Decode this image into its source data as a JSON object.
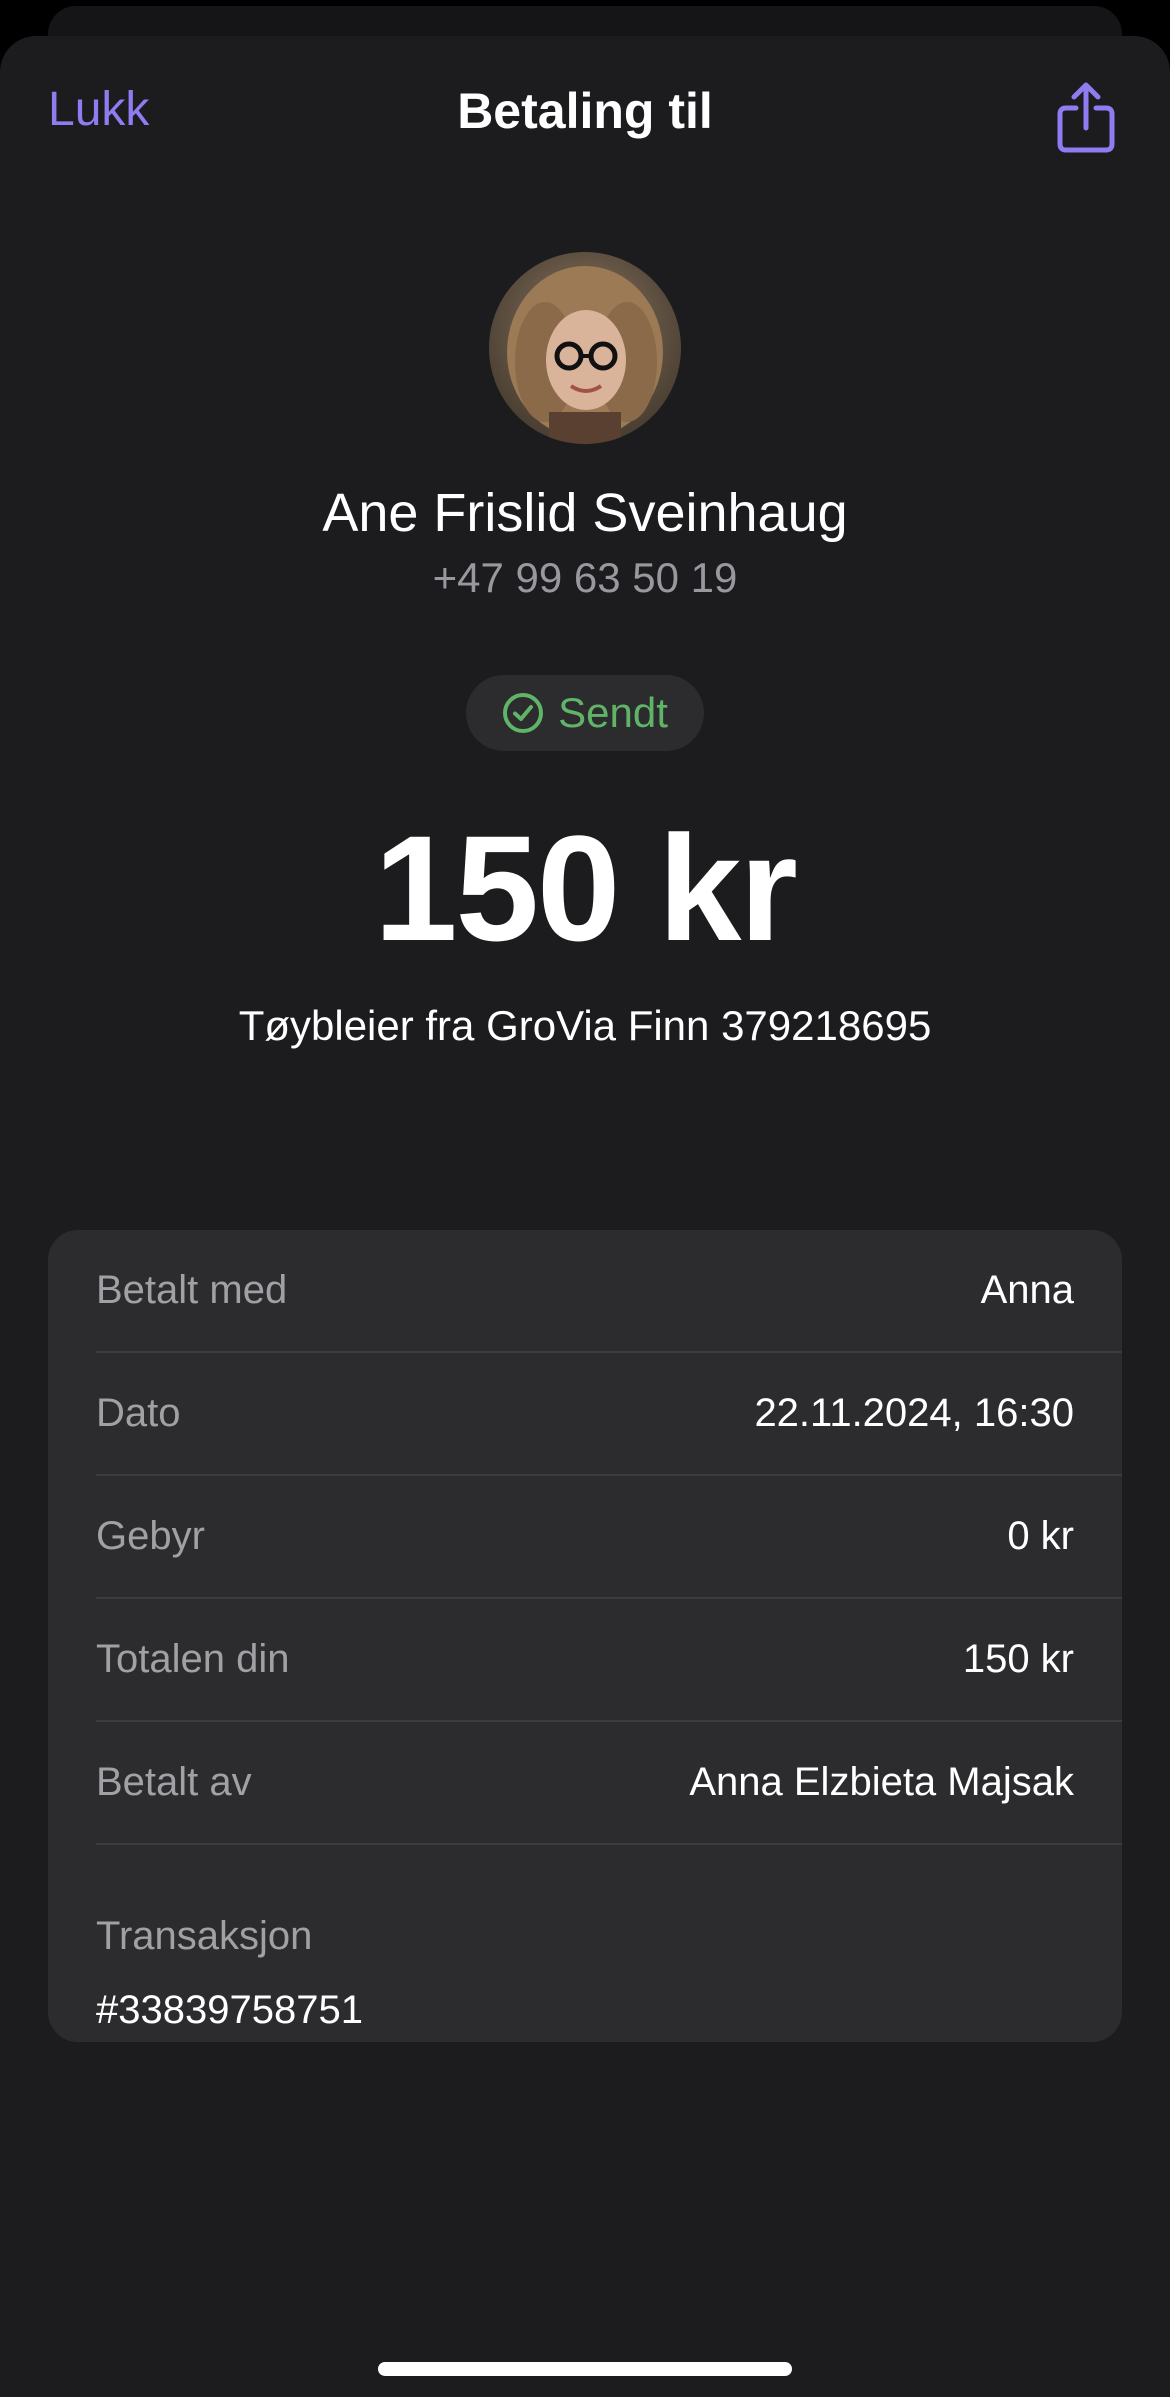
{
  "nav": {
    "close_label": "Lukk",
    "title": "Betaling til",
    "share_icon": "share-icon"
  },
  "recipient": {
    "name": "Ane Frislid Sveinhaug",
    "phone": "+47 99 63 50 19",
    "avatar": "avatar-photo"
  },
  "status": {
    "label": "Sendt",
    "icon": "check-circle-icon",
    "color": "#5fb468"
  },
  "payment": {
    "amount": "150 kr",
    "message": "Tøybleier fra GroVia Finn 379218695"
  },
  "details": {
    "rows": [
      {
        "label": "Betalt med",
        "value": "Anna"
      },
      {
        "label": "Dato",
        "value": "22.11.2024, 16:30"
      },
      {
        "label": "Gebyr",
        "value": "0 kr"
      },
      {
        "label": "Totalen din",
        "value": "150 kr"
      },
      {
        "label": "Betalt av",
        "value": "Anna Elzbieta Majsak"
      }
    ],
    "transaction_label": "Transaksjon",
    "transaction_value": "#33839758751"
  },
  "colors": {
    "accent": "#8e7cf0",
    "background": "#1c1c1e",
    "card": "#2c2c2e"
  }
}
